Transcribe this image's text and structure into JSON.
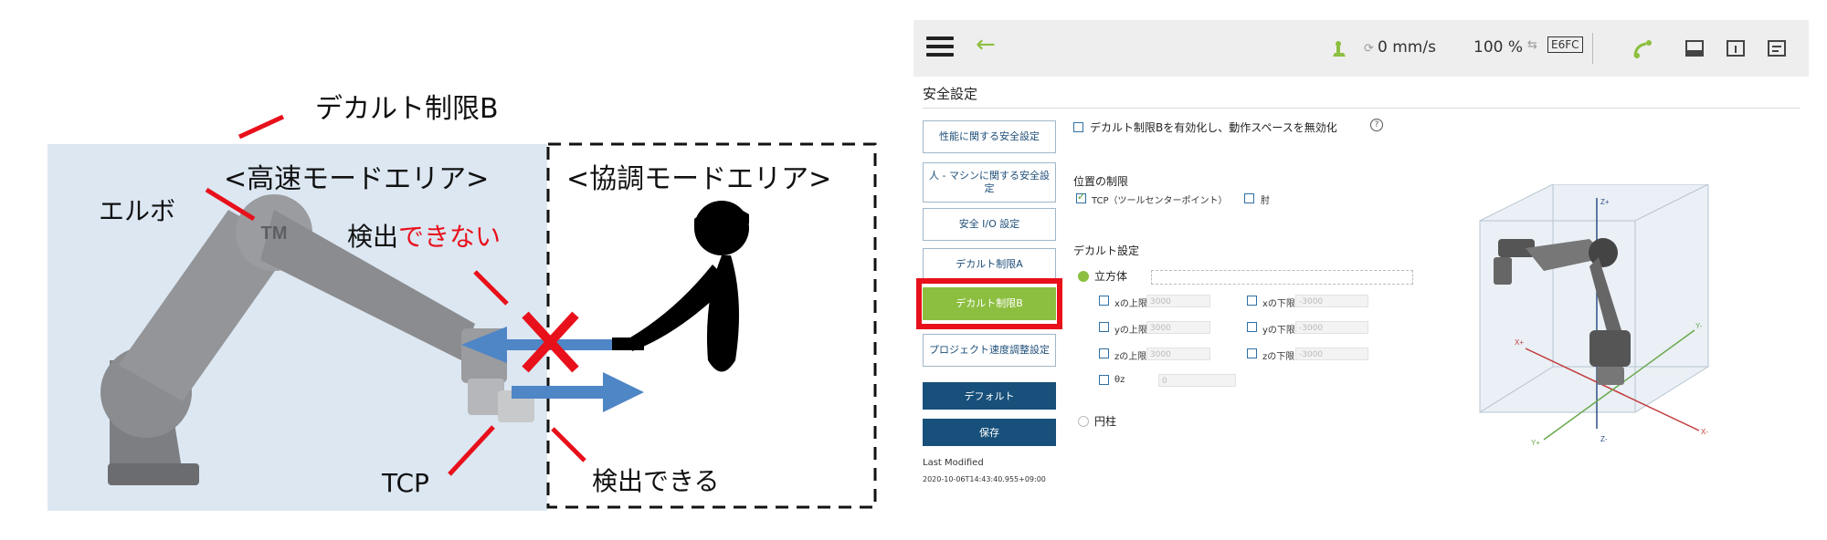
{
  "illustration": {
    "label_limit_b": "デカルト制限B",
    "label_high_speed_area": "<高速モードエリア>",
    "label_collab_area": "<協調モードエリア>",
    "label_elbow": "エルボ",
    "label_not_detected_prefix": "検出",
    "label_not_detected_suffix": "できない",
    "label_tcp": "TCP",
    "label_detected": "検出できる",
    "robot_logo": "TM",
    "colors": {
      "area_bg": "#dce7f2",
      "arrow": "#4f86c6",
      "cross": "#e8101b",
      "alert_text": "#e8101b"
    }
  },
  "toolbar": {
    "menu_icon": "hamburger-icon",
    "back_icon": "back-arrow-icon",
    "speed": "0 mm/s",
    "speed_ratio": "100 %",
    "mode_badge": "E6FC"
  },
  "page": {
    "title": "安全設定",
    "nav_items": [
      "性能に関する安全設定",
      "人 - マシンに関する安全設定",
      "安全 I/O 設定",
      "デカルト制限A",
      "デカルト制限B",
      "プロジェクト速度調整設定"
    ],
    "active_nav": "デカルト制限B",
    "default_button": "デフォルト",
    "save_button": "保存",
    "last_modified_label": "Last Modified",
    "last_modified_value": "2020-10-06T14:43:40.955+09:00"
  },
  "settings": {
    "enable_checkbox_label": "デカルト制限Bを有効化し、動作スペースを無効化",
    "help_icon": "help-circle-icon",
    "position_limit_title": "位置の制限",
    "tcp_label": "TCP（ツールセンターポイント）",
    "elbow_label": "肘",
    "cartesian_title": "デカルト設定",
    "cube_label": "立方体",
    "cylinder_label": "円柱",
    "fields": {
      "x_upper": "xの上限",
      "x_lower": "xの下限",
      "y_upper": "yの上限",
      "y_lower": "yの下限",
      "z_upper": "zの上限",
      "z_lower": "zの下限",
      "theta": "θz"
    },
    "field_values": {
      "upper": "3000",
      "lower": "-3000",
      "theta": "0"
    }
  },
  "axes": {
    "z_plus": "Z+",
    "z_minus": "Z-",
    "x_plus": "X+",
    "x_minus": "X-",
    "y_plus": "Y+",
    "y_minus": "Y-"
  }
}
